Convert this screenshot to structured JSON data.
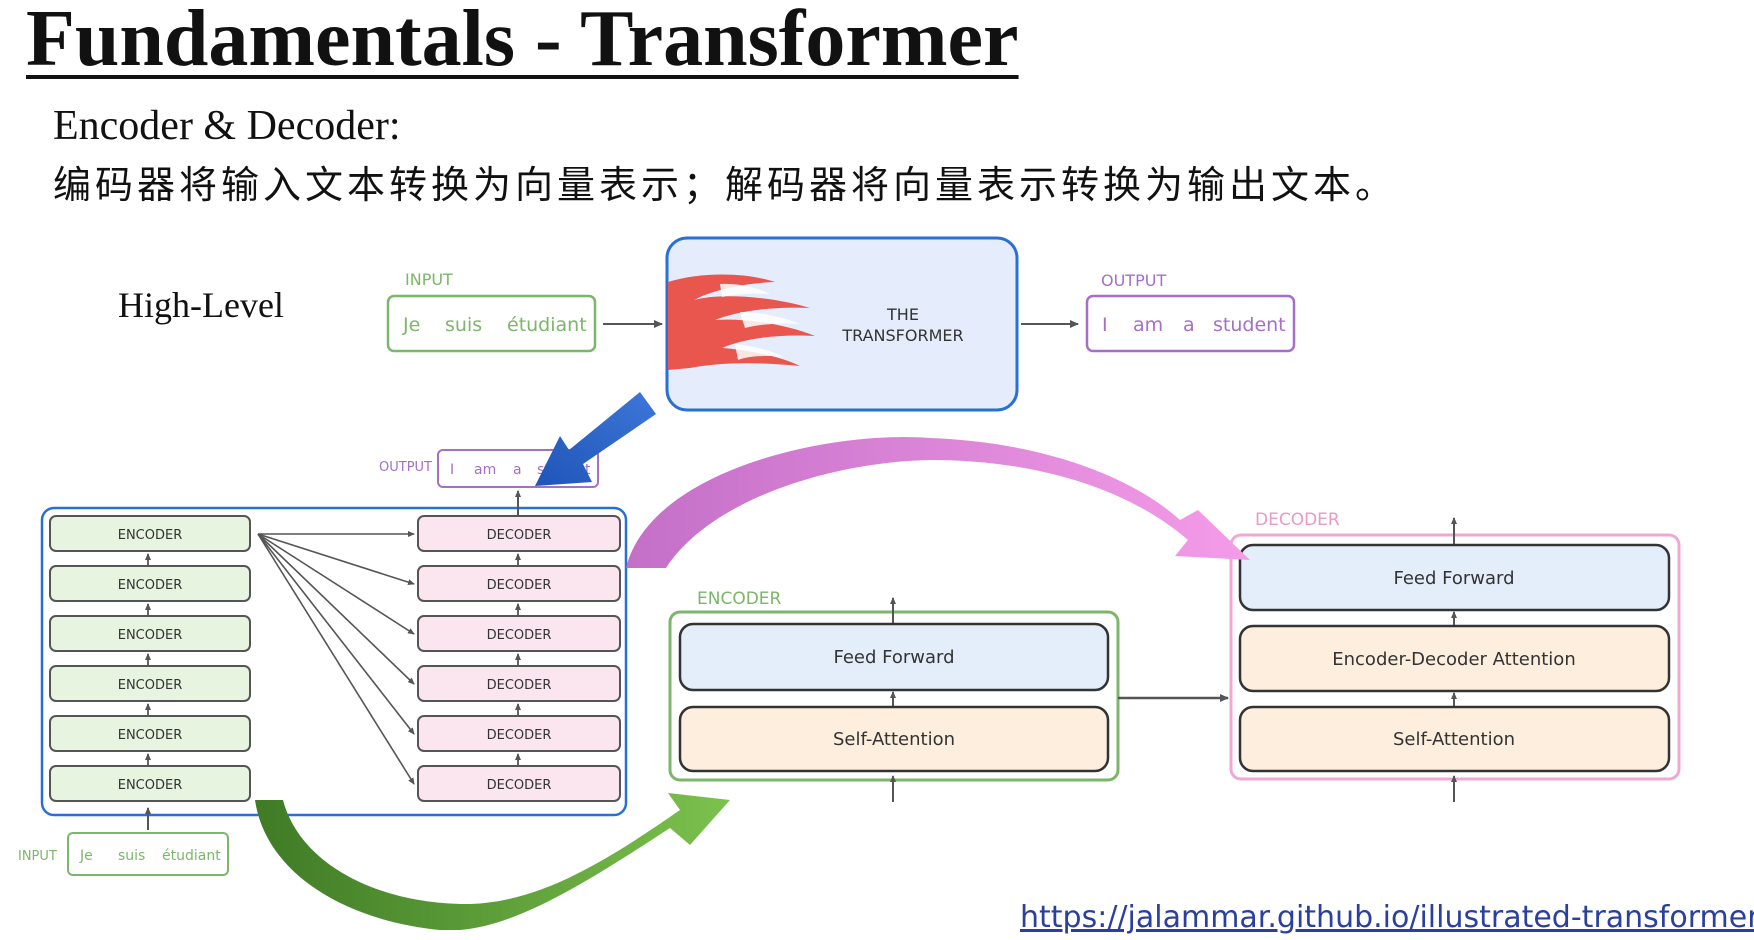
{
  "slide": {
    "title": "Fundamentals - Transformer",
    "subtitle": "Encoder & Decoder:",
    "description": "编码器将输入文本转换为向量表示；解码器将向量表示转换为输出文本。",
    "high_level_label": "High-Level",
    "source_link": "https://jalammar.github.io/illustrated-transformer/"
  },
  "top": {
    "input_label": "INPUT",
    "input_words": [
      "Je",
      "suis",
      "étudiant"
    ],
    "transformer_label_line1": "THE",
    "transformer_label_line2": "TRANSFORMER",
    "output_label": "OUTPUT",
    "output_words": [
      "I",
      "am",
      "a",
      "student"
    ]
  },
  "stack": {
    "output_label": "OUTPUT",
    "output_words": [
      "I",
      "am",
      "a",
      "student"
    ],
    "encoder_label": "ENCODER",
    "decoder_label": "DECODER",
    "count": 6,
    "input_label": "INPUT",
    "input_words": [
      "Je",
      "suis",
      "étudiant"
    ]
  },
  "encoder_detail": {
    "title": "ENCODER",
    "feed_forward": "Feed Forward",
    "self_attention": "Self-Attention"
  },
  "decoder_detail": {
    "title": "DECODER",
    "feed_forward": "Feed Forward",
    "enc_dec_attention": "Encoder-Decoder Attention",
    "self_attention": "Self-Attention"
  },
  "colors": {
    "green": "#7cb66b",
    "green_fill": "#e6f4e0",
    "pink": "#e89ac8",
    "pink_fill": "#fbe6ef",
    "purple": "#a56fc7",
    "blue": "#2a6fd6",
    "blue_fill": "#e5ecfb",
    "feed_fill": "#e3eefa",
    "attn_fill": "#fdeedd",
    "flame": "#e8564e"
  }
}
